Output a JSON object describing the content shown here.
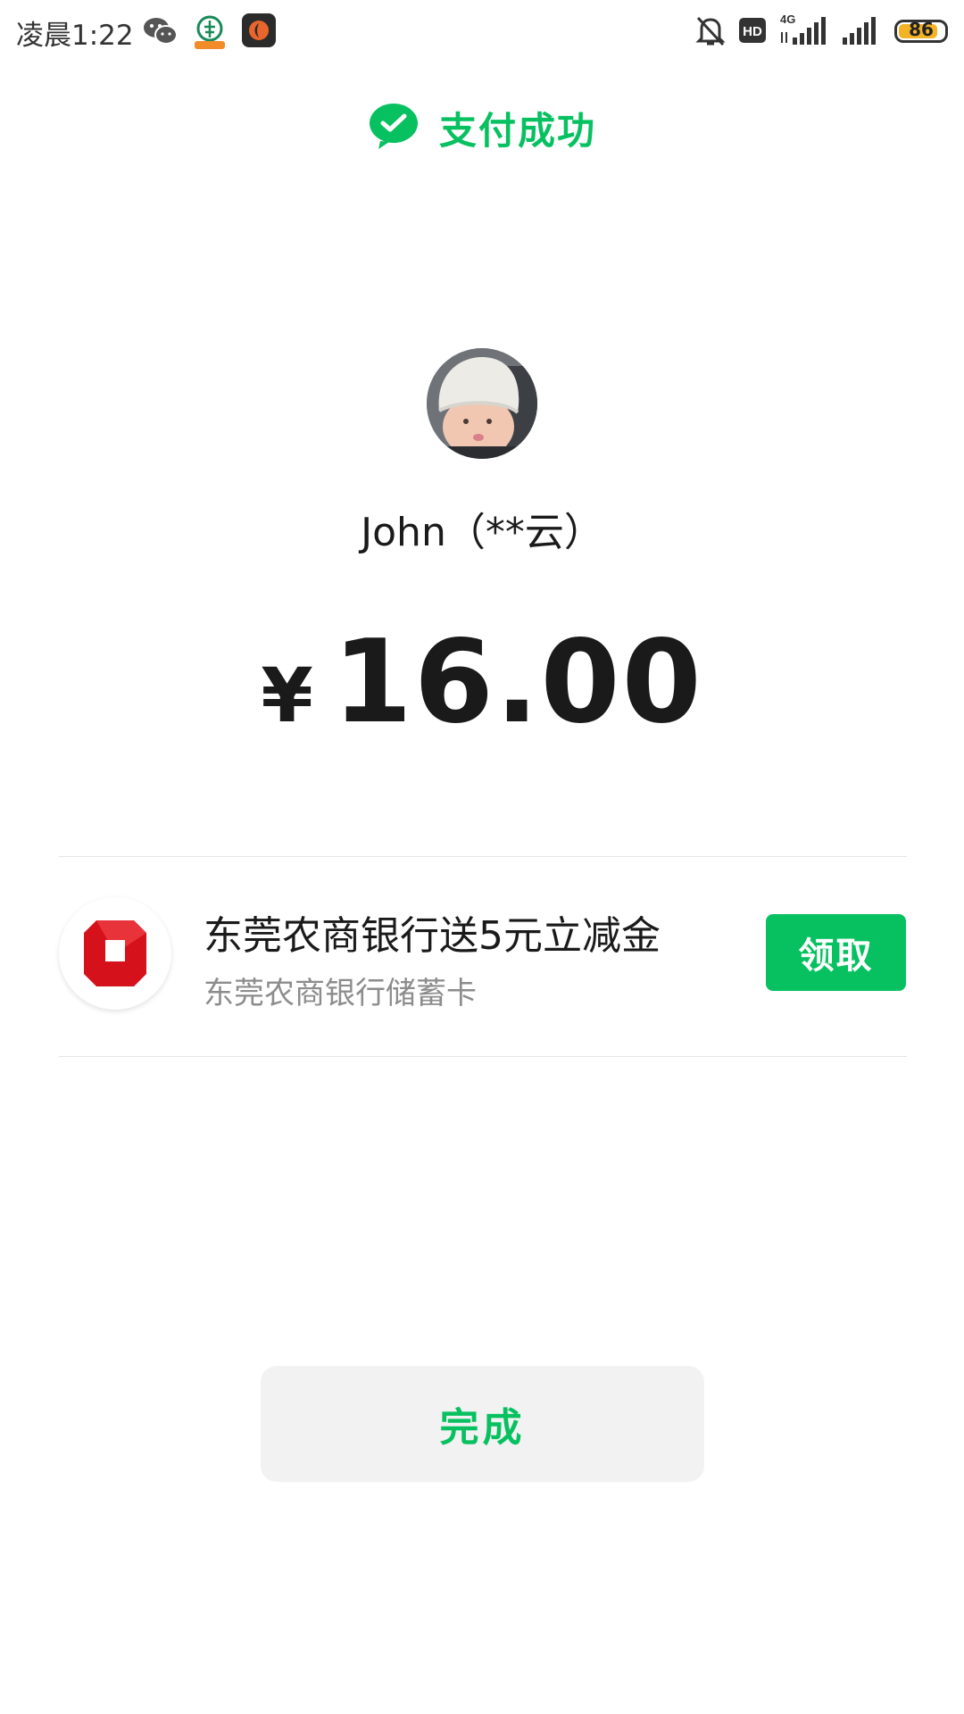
{
  "status_bar": {
    "time": "凌晨1:22",
    "network": "4G",
    "hd_label": "HD",
    "battery": "86",
    "battery_level": 0.86,
    "icons": [
      "wechat-icon",
      "bank-app-icon",
      "orange-app-icon",
      "mute-bell-icon",
      "hd-icon",
      "signal-4g-icon",
      "signal-icon",
      "battery-icon"
    ]
  },
  "header": {
    "title": "支付成功",
    "icon": "wechat-pay-check-icon",
    "accent_color": "#07c160"
  },
  "payee": {
    "name": "John（**云）",
    "avatar": "baby-avatar"
  },
  "payment": {
    "currency_symbol": "¥",
    "amount": "16.00"
  },
  "promo": {
    "title": "东莞农商银行送5元立减金",
    "subtitle": "东莞农商银行储蓄卡",
    "button_label": "领取",
    "logo": "dongguan-rural-bank-logo",
    "button_color": "#07c160"
  },
  "done_button": {
    "label": "完成"
  }
}
